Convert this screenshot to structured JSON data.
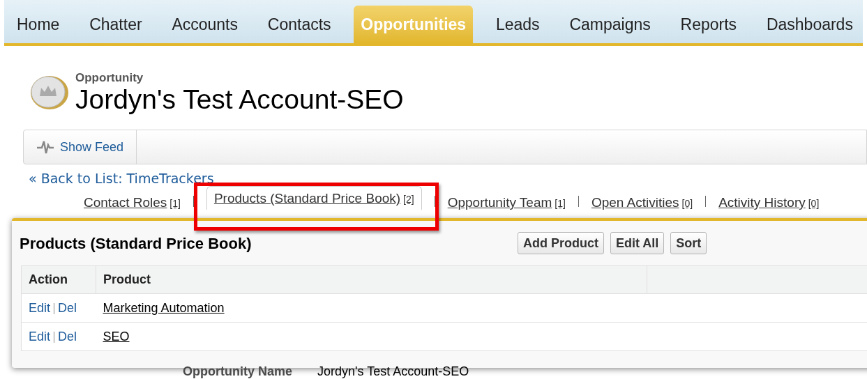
{
  "nav_tabs": [
    {
      "label": "Home",
      "selected": false
    },
    {
      "label": "Chatter",
      "selected": false
    },
    {
      "label": "Accounts",
      "selected": false
    },
    {
      "label": "Contacts",
      "selected": false
    },
    {
      "label": "Opportunities",
      "selected": true
    },
    {
      "label": "Leads",
      "selected": false
    },
    {
      "label": "Campaigns",
      "selected": false
    },
    {
      "label": "Reports",
      "selected": false
    },
    {
      "label": "Dashboards",
      "selected": false
    }
  ],
  "header": {
    "object_type": "Opportunity",
    "title": "Jordyn's Test Account-SEO"
  },
  "feed_button": "Show Feed",
  "back_link": "« Back to List: TimeTrackers",
  "related_lists": [
    {
      "label": "Contact Roles",
      "count": "[1]",
      "selected": false
    },
    {
      "label": "Products (Standard Price Book)",
      "count": "[2]",
      "selected": true
    },
    {
      "label": "Opportunity Team",
      "count": "[1]",
      "selected": false
    },
    {
      "label": "Open Activities",
      "count": "[0]",
      "selected": false
    },
    {
      "label": "Activity History",
      "count": "[0]",
      "selected": false
    }
  ],
  "panel": {
    "title": "Products (Standard Price Book)",
    "buttons": [
      "Add Product",
      "Edit All",
      "Sort"
    ],
    "table": {
      "columns": [
        "Action",
        "Product"
      ],
      "rows": [
        {
          "actions": [
            "Edit",
            "Del"
          ],
          "product": "Marketing Automation"
        },
        {
          "actions": [
            "Edit",
            "Del"
          ],
          "product": "SEO"
        }
      ]
    }
  },
  "detail": {
    "label": "Opportunity Name",
    "value": "Jordyn's Test Account-SEO"
  }
}
